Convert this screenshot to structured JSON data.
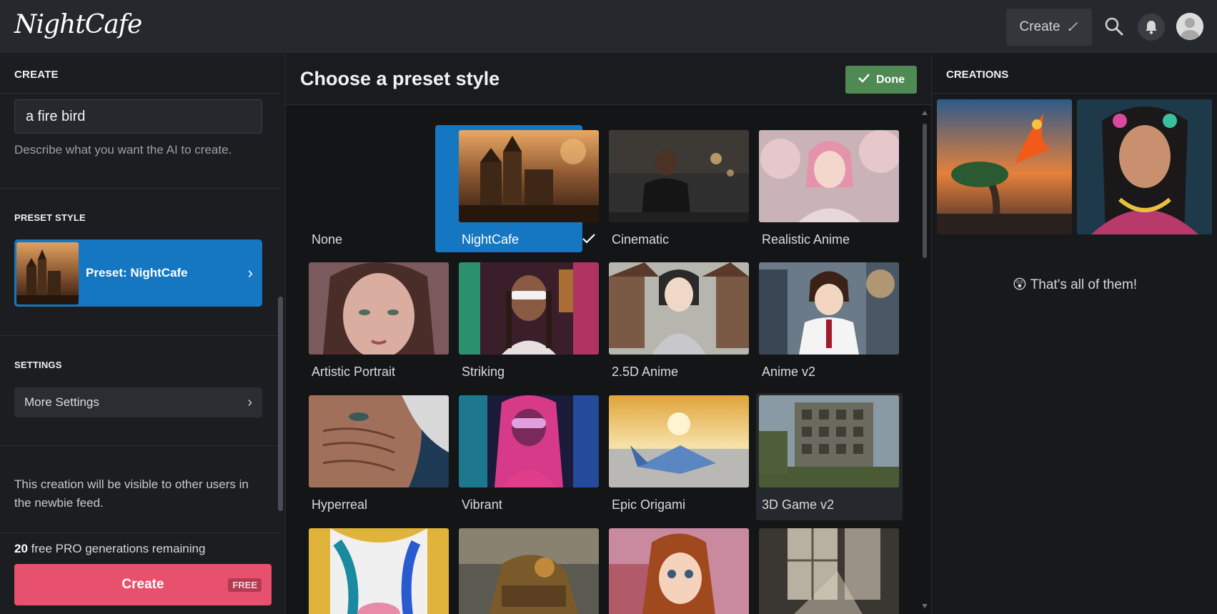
{
  "app": {
    "logo_text": "NightCafe"
  },
  "topbar": {
    "create_label": "Create",
    "icons": [
      "brush-icon",
      "search-icon",
      "bell-icon",
      "avatar"
    ]
  },
  "left_panel": {
    "create_heading": "CREATE",
    "prompt_value": "a fire bird",
    "prompt_help": "Describe what you want the AI to create.",
    "preset_heading": "PRESET STYLE",
    "preset_label": "Preset: NightCafe",
    "settings_heading": "SETTINGS",
    "more_settings_label": "More Settings",
    "visibility_note": "This creation will be visible to other users in the newbie feed.",
    "remaining_count": "20",
    "remaining_text": " free PRO generations remaining",
    "create_button_label": "Create",
    "free_badge": "FREE"
  },
  "middle_panel": {
    "title": "Choose a preset style",
    "done_label": "Done",
    "styles": [
      {
        "name": "None"
      },
      {
        "name": "NightCafe",
        "selected": true
      },
      {
        "name": "Cinematic"
      },
      {
        "name": "Realistic Anime"
      },
      {
        "name": "Artistic Portrait"
      },
      {
        "name": "Striking"
      },
      {
        "name": "2.5D Anime"
      },
      {
        "name": "Anime v2"
      },
      {
        "name": "Hyperreal"
      },
      {
        "name": "Vibrant"
      },
      {
        "name": "Epic Origami"
      },
      {
        "name": "3D Game v2",
        "hovered": true
      },
      {
        "name": ""
      },
      {
        "name": ""
      },
      {
        "name": ""
      },
      {
        "name": ""
      }
    ]
  },
  "right_panel": {
    "heading": "CREATIONS",
    "end_message": "That's all of them!",
    "end_emoji": "😲"
  },
  "colors": {
    "accent_blue": "#1577c2",
    "create_pink": "#e8516e",
    "done_green": "#4f8a55",
    "background": "#131517"
  }
}
